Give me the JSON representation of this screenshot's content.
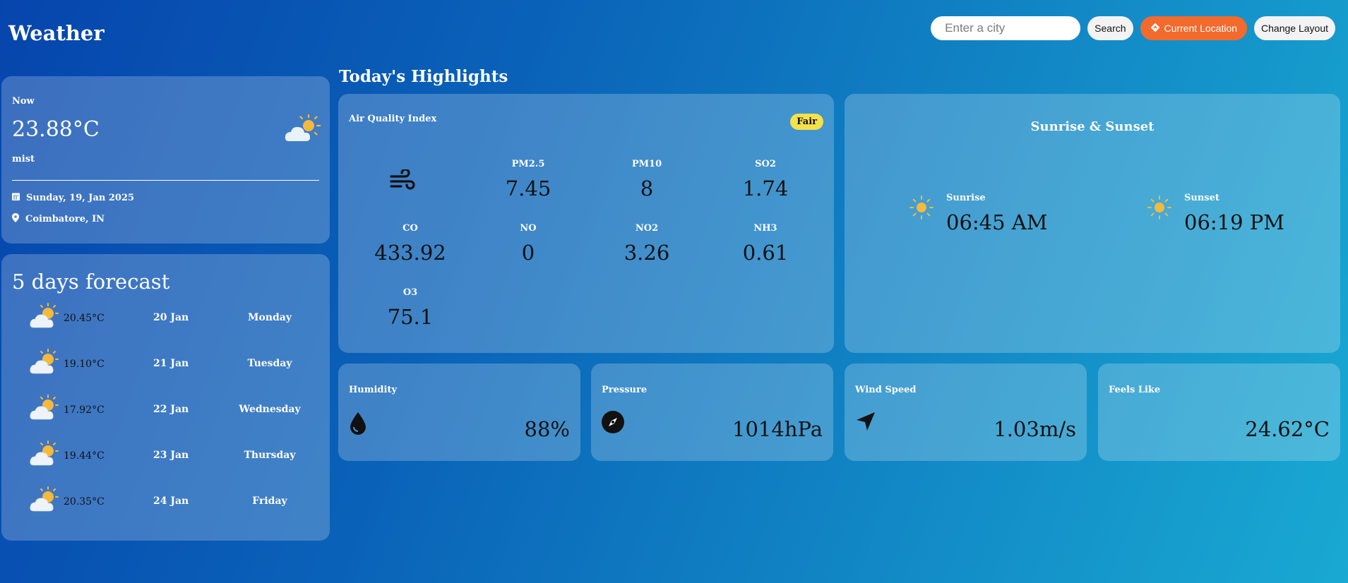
{
  "app": {
    "title": "Weather"
  },
  "search": {
    "placeholder": "Enter a city",
    "button": "Search",
    "location_button": "Current Location",
    "layout_button": "Change Layout"
  },
  "current": {
    "label": "Now",
    "temperature": "23.88°C",
    "description": "mist",
    "date": "Sunday, 19, Jan 2025",
    "location": "Coimbatore, IN"
  },
  "forecast": {
    "title": "5 days forecast",
    "days": [
      {
        "temp": "20.45°C",
        "date": "20 Jan",
        "weekday": "Monday"
      },
      {
        "temp": "19.10°C",
        "date": "21 Jan",
        "weekday": "Tuesday"
      },
      {
        "temp": "17.92°C",
        "date": "22 Jan",
        "weekday": "Wednesday"
      },
      {
        "temp": "19.44°C",
        "date": "23 Jan",
        "weekday": "Thursday"
      },
      {
        "temp": "20.35°C",
        "date": "24 Jan",
        "weekday": "Friday"
      }
    ]
  },
  "highlights": {
    "title": "Today's Highlights",
    "aqi": {
      "title": "Air Quality Index",
      "badge": "Fair",
      "badge_color": "#f5e14a",
      "items": [
        {
          "name": "PM2.5",
          "value": "7.45"
        },
        {
          "name": "PM10",
          "value": "8"
        },
        {
          "name": "SO2",
          "value": "1.74"
        },
        {
          "name": "CO",
          "value": "433.92"
        },
        {
          "name": "NO",
          "value": "0"
        },
        {
          "name": "NO2",
          "value": "3.26"
        },
        {
          "name": "NH3",
          "value": "0.61"
        },
        {
          "name": "O3",
          "value": "75.1"
        }
      ]
    },
    "sun": {
      "title": "Sunrise & Sunset",
      "sunrise_label": "Sunrise",
      "sunrise": "06:45 AM",
      "sunset_label": "Sunset",
      "sunset": "06:19 PM"
    },
    "humidity": {
      "label": "Humidity",
      "value": "88%"
    },
    "pressure": {
      "label": "Pressure",
      "value": "1014hPa"
    },
    "wind": {
      "label": "Wind Speed",
      "value": "1.03m/s"
    },
    "feels_like": {
      "label": "Feels Like",
      "value": "24.62°C"
    }
  },
  "colors": {
    "accent_orange": "#f36a2d",
    "background_start": "#0645ad",
    "background_end": "#19a9d2"
  }
}
